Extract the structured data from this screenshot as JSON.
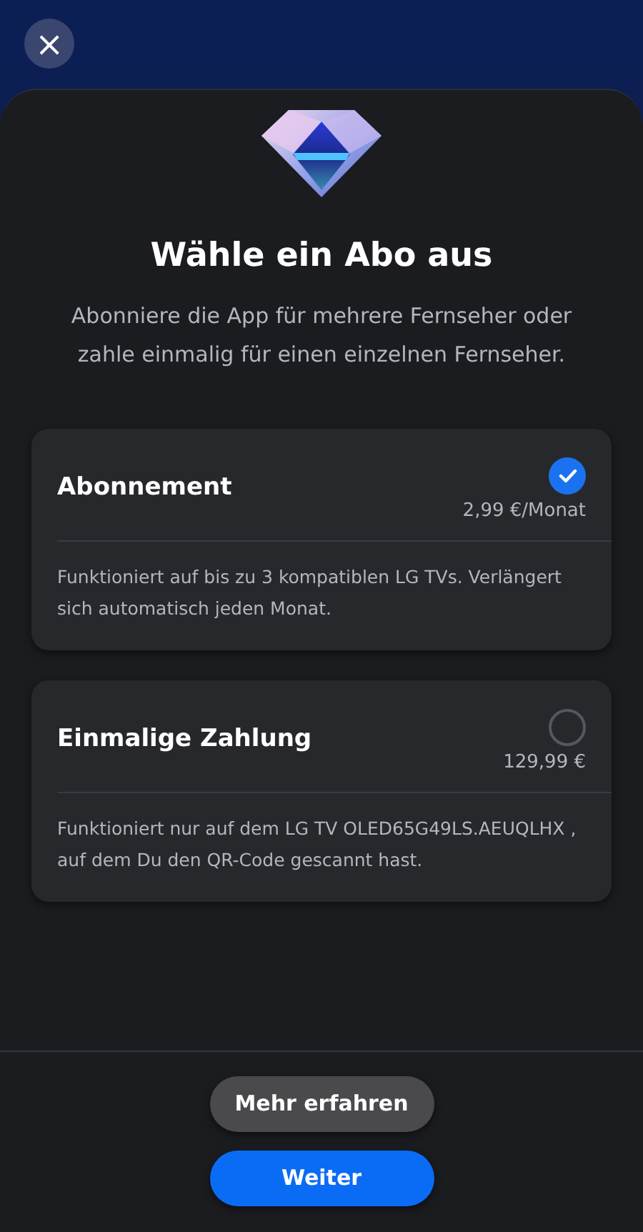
{
  "close_button": {
    "label": "×"
  },
  "title": "Wähle ein Abo aus",
  "subtitle": "Abonniere die App für mehrere Fernseher oder zahle einmalig für einen einzelnen Fernseher.",
  "plans": [
    {
      "name": "Abonnement",
      "price": "2,99 €/Monat",
      "description": "Funktioniert auf bis zu 3 kompatiblen LG TVs. Verlängert sich automatisch jeden Monat.",
      "selected": true
    },
    {
      "name": "Einmalige Zahlung",
      "price": "129,99 €",
      "description": "Funktioniert nur auf dem LG TV OLED65G49LS.AEUQLHX , auf dem Du den QR-Code gescannt hast.",
      "selected": false
    }
  ],
  "buttons": [
    {
      "label": "Mehr erfahren",
      "kind": "secondary"
    },
    {
      "label": "Weiter",
      "kind": "primary"
    }
  ]
}
